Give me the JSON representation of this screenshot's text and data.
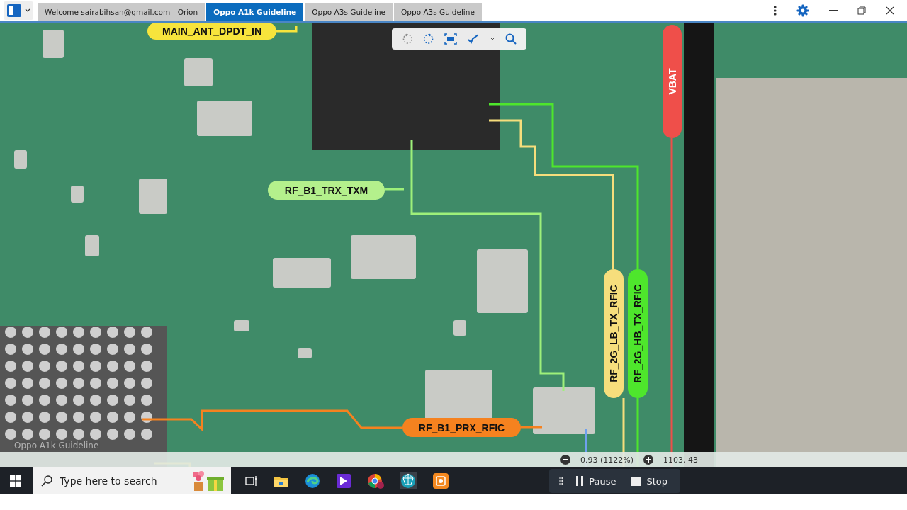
{
  "tabs": [
    {
      "label": "Welcome sairabihsan@gmail.com - Orion",
      "selected": false
    },
    {
      "label": "Oppo A1k Guideline",
      "selected": true
    },
    {
      "label": "Oppo A3s Guideline",
      "selected": false
    },
    {
      "label": "Oppo A3s Guideline",
      "selected": false
    }
  ],
  "board": {
    "watermark": "Oppo A1k Guideline",
    "labels": [
      {
        "text": "MAIN_ANT_DPDT_IN",
        "kind": "horizontal",
        "color": "#f7e43c"
      },
      {
        "text": "RF_B1_TRX_TXM",
        "kind": "horizontal",
        "color": "#b4f08c"
      },
      {
        "text": "VBAT",
        "kind": "vertical",
        "color": "#ef4f4a"
      },
      {
        "text": "RF_2G_LB_TX_RFIC",
        "kind": "vertical",
        "color": "#f6de7c"
      },
      {
        "text": "RF_2G_HB_TX_RFIC",
        "kind": "vertical",
        "color": "#4ee62c"
      },
      {
        "text": "RF_B1_PRX_RFIC",
        "kind": "horizontal",
        "color": "#f5821f"
      }
    ]
  },
  "status": {
    "zoom": "0.93 (1122%)",
    "coordinates": "1103, 43"
  },
  "taskbar": {
    "search": {
      "placeholder": "Type here to search"
    }
  },
  "recorder": {
    "buttons": [
      {
        "label": "Pause",
        "kind": "pause"
      },
      {
        "label": "Stop",
        "kind": "stop"
      }
    ]
  }
}
